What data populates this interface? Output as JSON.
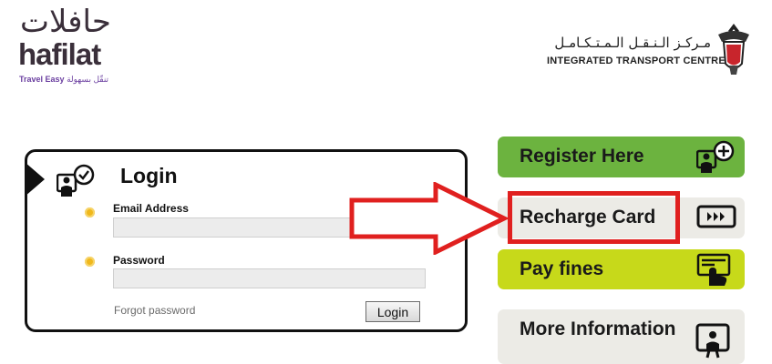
{
  "branding": {
    "hafilat_logo_arabic": "حافلات",
    "hafilat_logo_text": "hafilat",
    "hafilat_tagline_en": "Travel Easy",
    "hafilat_tagline_ar": "تنقّل بسهولة",
    "itc_name_ar": "مـركـز الـنـقـل الـمـتـكـامـل",
    "itc_name_en": "INTEGRATED TRANSPORT CENTRE"
  },
  "login": {
    "title": "Login",
    "email_label": "Email Address",
    "email_value": "",
    "password_label": "Password",
    "password_value": "",
    "forgot_password": "Forgot password",
    "submit_label": "Login"
  },
  "menu": {
    "register": "Register Here",
    "recharge": "Recharge Card",
    "pay_fines": "Pay fines",
    "more_info": "More Information"
  },
  "colors": {
    "register_bg": "#6cb33f",
    "pay_fines_bg": "#c7d91a",
    "neutral_bg": "#ecebe6",
    "annotation_red": "#e0201f"
  },
  "icons": [
    "user-check-icon",
    "user-add-icon",
    "card-tap-icon",
    "payment-hand-icon",
    "info-board-icon"
  ]
}
